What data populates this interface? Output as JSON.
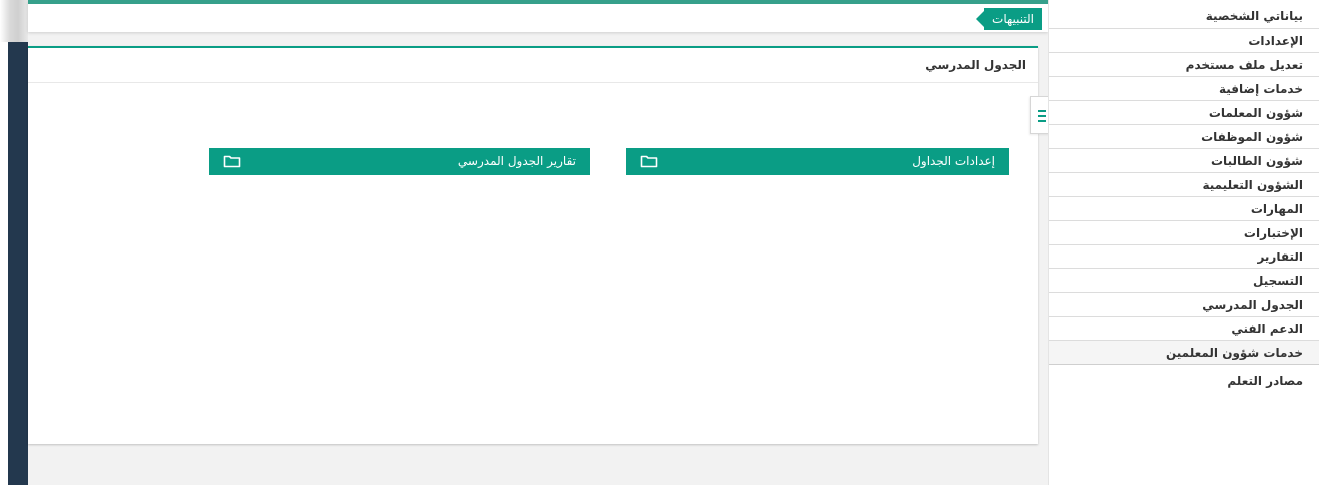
{
  "topbar": {
    "alerts_label": "التنبيهات"
  },
  "panel": {
    "title": "الجدول المدرسي",
    "buttons": [
      {
        "label": "إعدادات الجداول",
        "icon": "folder-icon"
      },
      {
        "label": "تقارير الجدول المدرسي",
        "icon": "folder-icon"
      }
    ]
  },
  "sidebar": {
    "items": [
      {
        "label": "بياناتي الشخصية"
      },
      {
        "label": "الإعدادات"
      },
      {
        "label": "تعديل ملف مستخدم"
      },
      {
        "label": "خدمات إضافية"
      },
      {
        "label": "شؤون المعلمات"
      },
      {
        "label": "شؤون الموظفات"
      },
      {
        "label": "شؤون الطالبات"
      },
      {
        "label": "الشؤون التعليمية"
      },
      {
        "label": "المهارات"
      },
      {
        "label": "الإختبارات"
      },
      {
        "label": "التقارير"
      },
      {
        "label": "التسجيل"
      },
      {
        "label": "الجدول المدرسي"
      },
      {
        "label": "الدعم الفني"
      },
      {
        "label": "خدمات شؤون المعلمين"
      },
      {
        "label": "مصادر التعلم"
      }
    ]
  },
  "colors": {
    "accent": "#0a9d85",
    "dark_strip": "#23384e",
    "content_bg": "#f2f2f2"
  }
}
